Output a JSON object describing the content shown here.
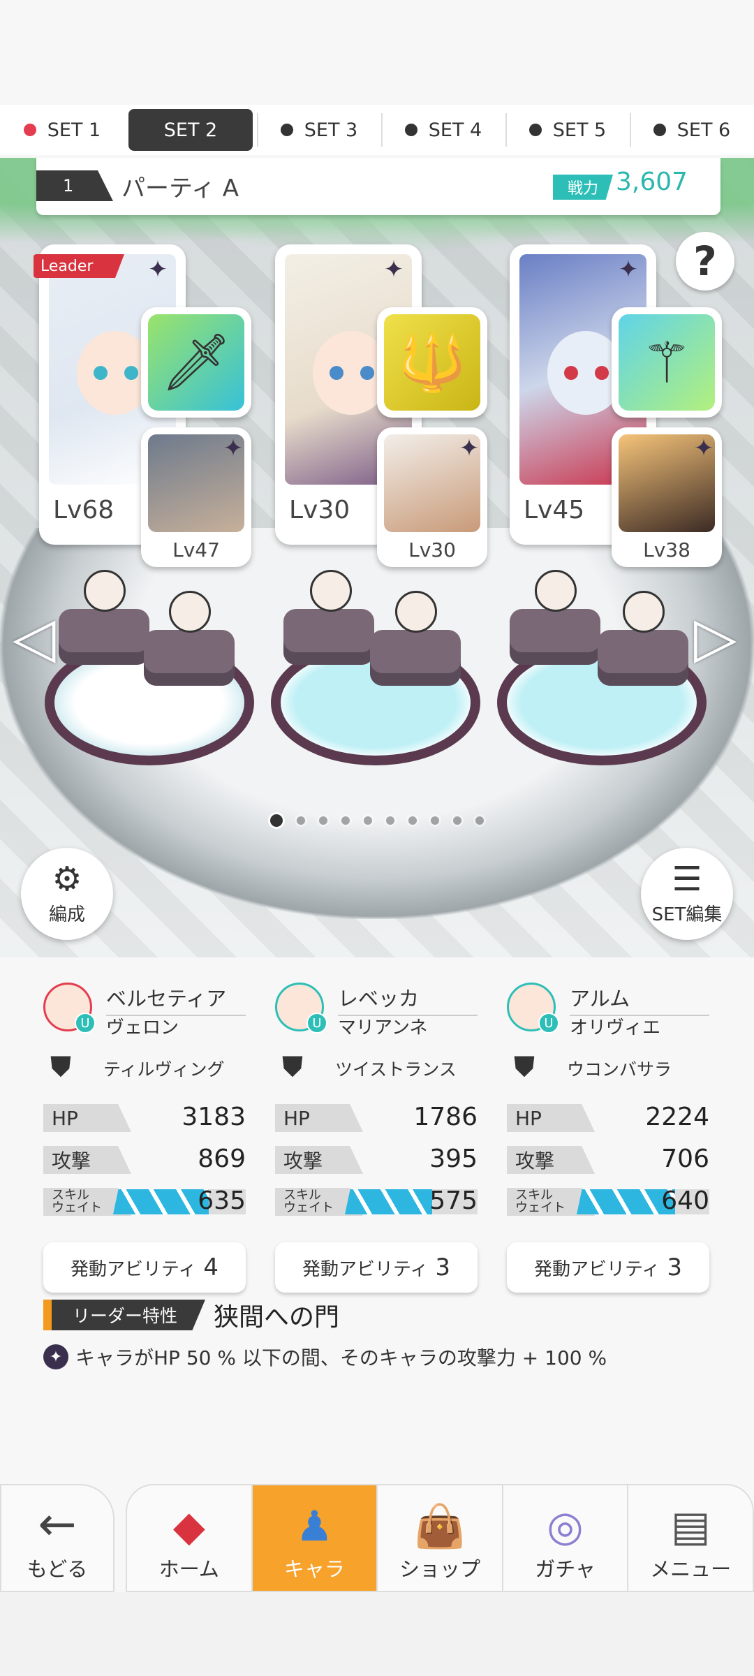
{
  "set_tabs": [
    {
      "label": "SET 1",
      "dot": "red",
      "active": false
    },
    {
      "label": "SET 2",
      "dot": "none",
      "active": true
    },
    {
      "label": "SET 3",
      "dot": "dark",
      "active": false
    },
    {
      "label": "SET 4",
      "dot": "dark",
      "active": false
    },
    {
      "label": "SET 5",
      "dot": "dark",
      "active": false
    },
    {
      "label": "SET 6",
      "dot": "dark",
      "active": false
    }
  ],
  "party": {
    "number": "1",
    "name": "パーティ A",
    "power_label": "戦力",
    "power_value": "3,607"
  },
  "help_label": "?",
  "leader_badge": "Leader",
  "cards": [
    {
      "main_level": "Lv68",
      "sub_level": "Lv47",
      "weapon_icon": "sword-icon"
    },
    {
      "main_level": "Lv30",
      "sub_level": "Lv30",
      "weapon_icon": "spear-icon"
    },
    {
      "main_level": "Lv45",
      "sub_level": "Lv38",
      "weapon_icon": "staff-icon"
    }
  ],
  "arrows": {
    "left": "◁",
    "right": "▷"
  },
  "page_dots": {
    "count": 10,
    "active": 0
  },
  "buttons": {
    "formation": "編成",
    "set_edit": "SET編集"
  },
  "characters": [
    {
      "name": "ベルセティア",
      "sub": "ヴェロン",
      "weapon": "ティルヴィング",
      "hp": "3183",
      "atk": "869",
      "skill_wait": "635",
      "skill_fill": 0.72,
      "ability_label": "発動アビリティ",
      "ability_count": "4"
    },
    {
      "name": "レベッカ",
      "sub": "マリアンネ",
      "weapon": "ツイストランス",
      "hp": "1786",
      "atk": "395",
      "skill_wait": "575",
      "skill_fill": 0.66,
      "ability_label": "発動アビリティ",
      "ability_count": "3"
    },
    {
      "name": "アルム",
      "sub": "オリヴィエ",
      "weapon": "ウコンバサラ",
      "hp": "2224",
      "atk": "706",
      "skill_wait": "640",
      "skill_fill": 0.74,
      "ability_label": "発動アビリティ",
      "ability_count": "3"
    }
  ],
  "stat_labels": {
    "hp": "HP",
    "atk": "攻撃",
    "skill_1": "スキル",
    "skill_2": "ウェイト"
  },
  "leader_trait": {
    "tag": "リーダー特性",
    "name": "狭間への門",
    "desc": "キャラがHP 50 % 以下の間、そのキャラの攻撃力 + 100 %"
  },
  "nav": {
    "back": "もどる",
    "items": [
      {
        "label": "ホーム",
        "icon": "home-icon",
        "active": false
      },
      {
        "label": "キャラ",
        "icon": "character-icon",
        "active": true
      },
      {
        "label": "ショップ",
        "icon": "shop-icon",
        "active": false
      },
      {
        "label": "ガチャ",
        "icon": "gacha-icon",
        "active": false
      },
      {
        "label": "メニュー",
        "icon": "menu-icon",
        "active": false
      }
    ]
  },
  "colors": {
    "accent_orange": "#f7a22b",
    "teal": "#2dbfb7",
    "leader_red": "#d9333f",
    "skill_blue": "#2cb6e0"
  }
}
